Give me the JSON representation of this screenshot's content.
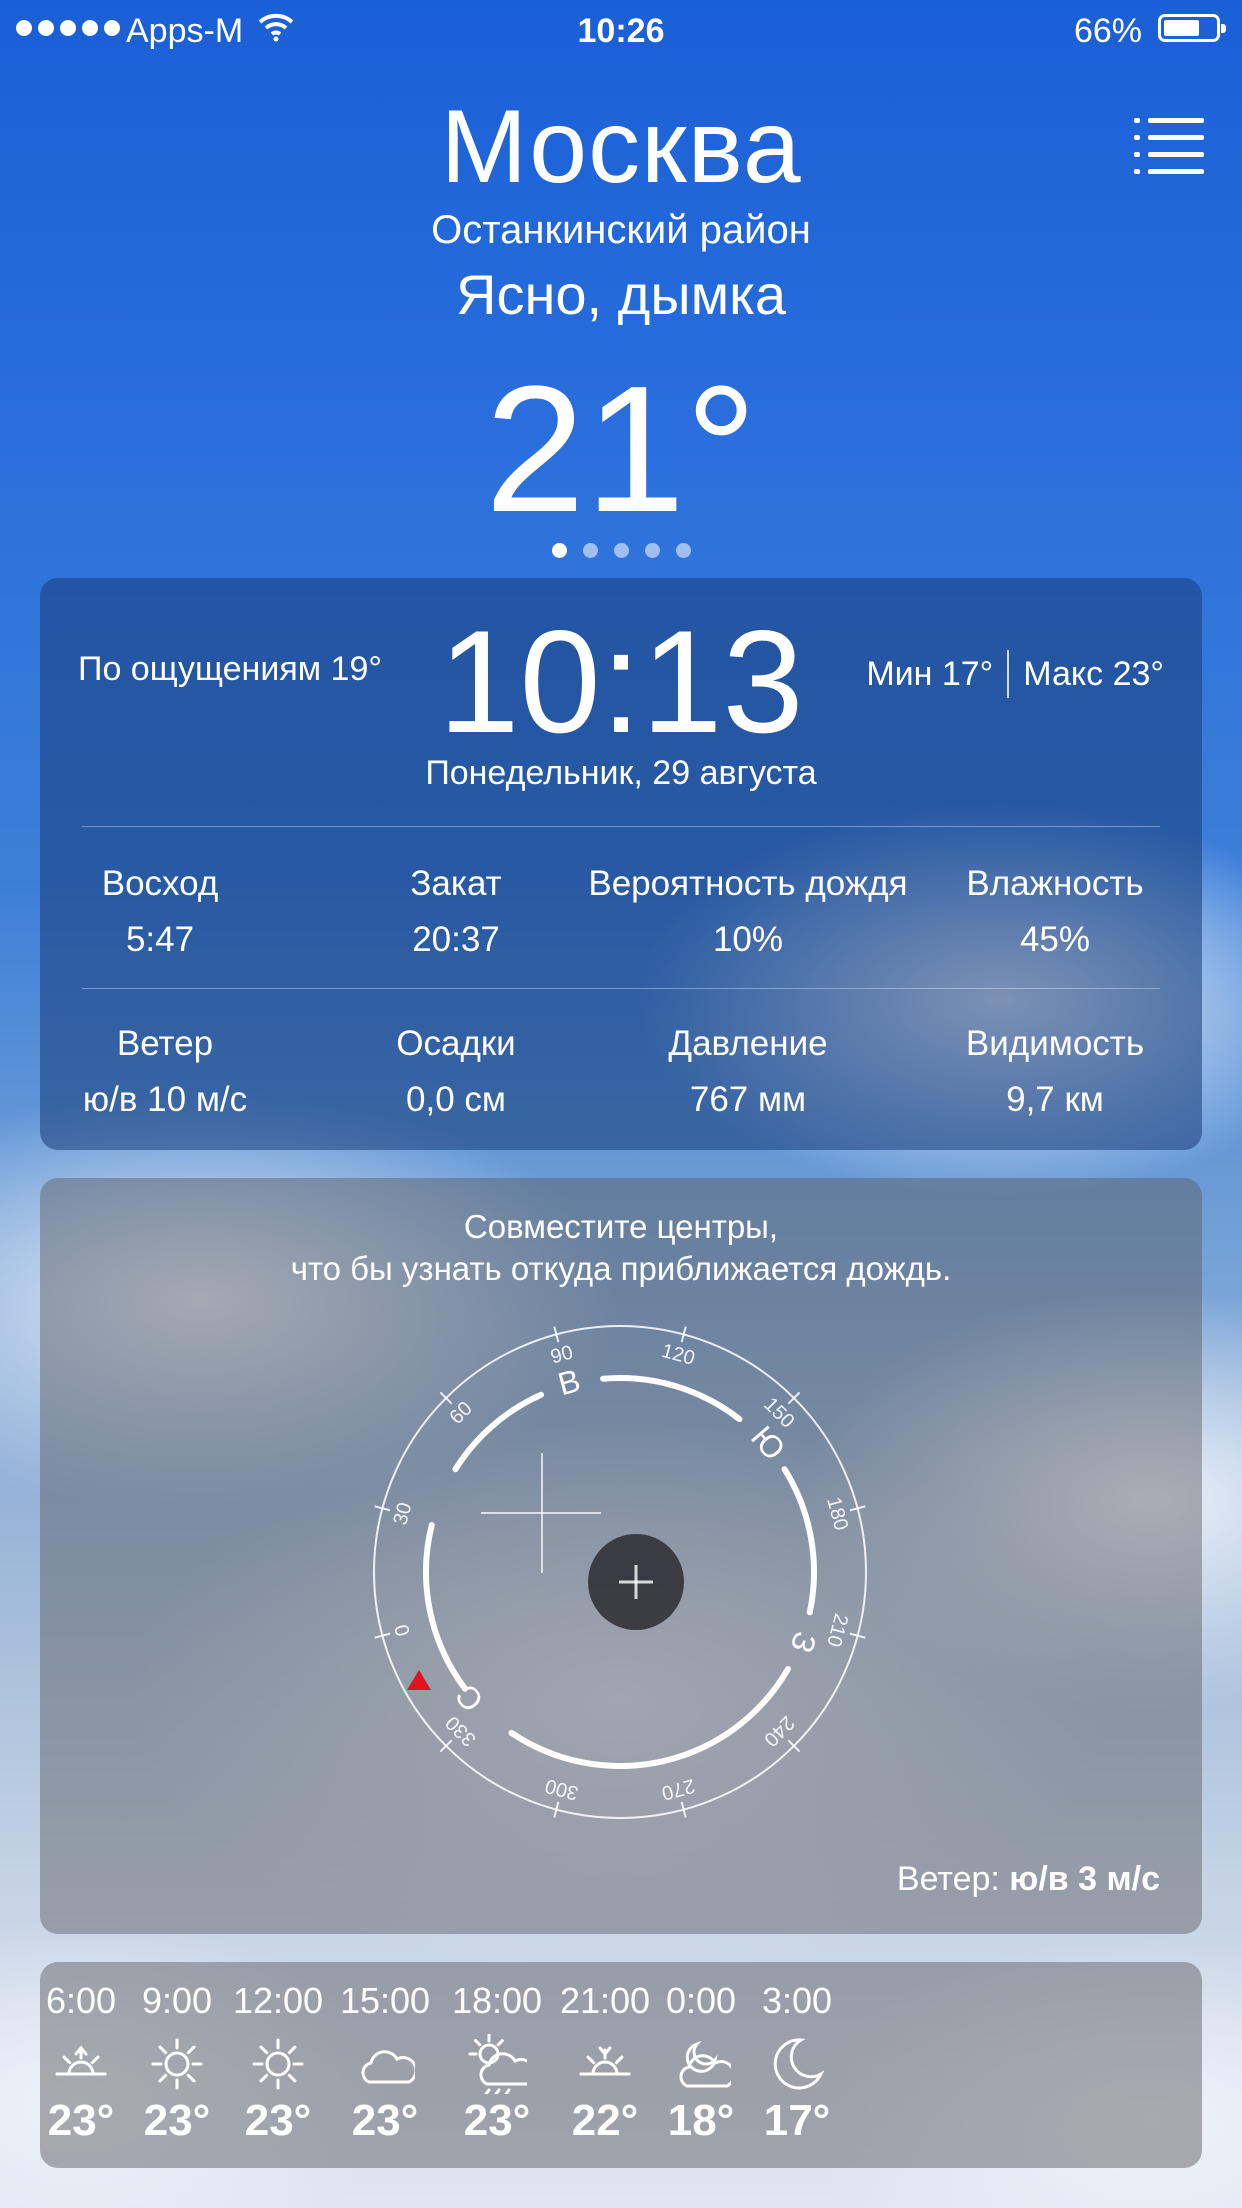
{
  "status_bar": {
    "carrier": "Apps-M",
    "time": "10:26",
    "battery": "66%",
    "battery_level": 0.66
  },
  "header": {
    "city": "Москва",
    "district": "Останкинский район",
    "condition": "Ясно, дымка",
    "temperature": "21°",
    "page_count": 5,
    "active_page": 1
  },
  "summary": {
    "feels_like": "По ощущениям 19°",
    "time": "10:13",
    "min": "Мин 17°",
    "max": "Макс 23°",
    "date": "Понедельник, 29 августа",
    "stats": [
      {
        "label": "Восход",
        "value": "5:47"
      },
      {
        "label": "Закат",
        "value": "20:37"
      },
      {
        "label": "Вероятность дождя",
        "value": "10%"
      },
      {
        "label": "Влажность",
        "value": "45%"
      },
      {
        "label": "Ветер",
        "value": "ю/в 10 м/с"
      },
      {
        "label": "Осадки",
        "value": "0,0 см"
      },
      {
        "label": "Давление",
        "value": "767 мм"
      },
      {
        "label": "Видимость",
        "value": "9,7 км"
      }
    ]
  },
  "radar": {
    "hint_line1": "Совместите центры,",
    "hint_line2": "что бы узнать откуда приближается дождь.",
    "ticks": [
      "0",
      "30",
      "60",
      "90",
      "120",
      "150",
      "180",
      "210",
      "240",
      "270",
      "300",
      "330"
    ],
    "directions": {
      "north": "С",
      "east": "В",
      "south": "Ю",
      "west": "З"
    },
    "wind_label": "Ветер:",
    "wind_value": "ю/в 3 м/с",
    "accent_color": "#e0141e"
  },
  "hourly": [
    {
      "time": "6:00",
      "icon": "sunrise-icon",
      "temp": "23°"
    },
    {
      "time": "9:00",
      "icon": "sun-icon",
      "temp": "23°"
    },
    {
      "time": "12:00",
      "icon": "sun-icon",
      "temp": "23°"
    },
    {
      "time": "15:00",
      "icon": "cloud-icon",
      "temp": "23°"
    },
    {
      "time": "18:00",
      "icon": "sun-cloud-rain-icon",
      "temp": "23°"
    },
    {
      "time": "21:00",
      "icon": "sunset-icon",
      "temp": "22°"
    },
    {
      "time": "0:00",
      "icon": "moon-cloud-icon",
      "temp": "18°"
    },
    {
      "time": "3:00",
      "icon": "moon-icon",
      "temp": "17°"
    }
  ]
}
